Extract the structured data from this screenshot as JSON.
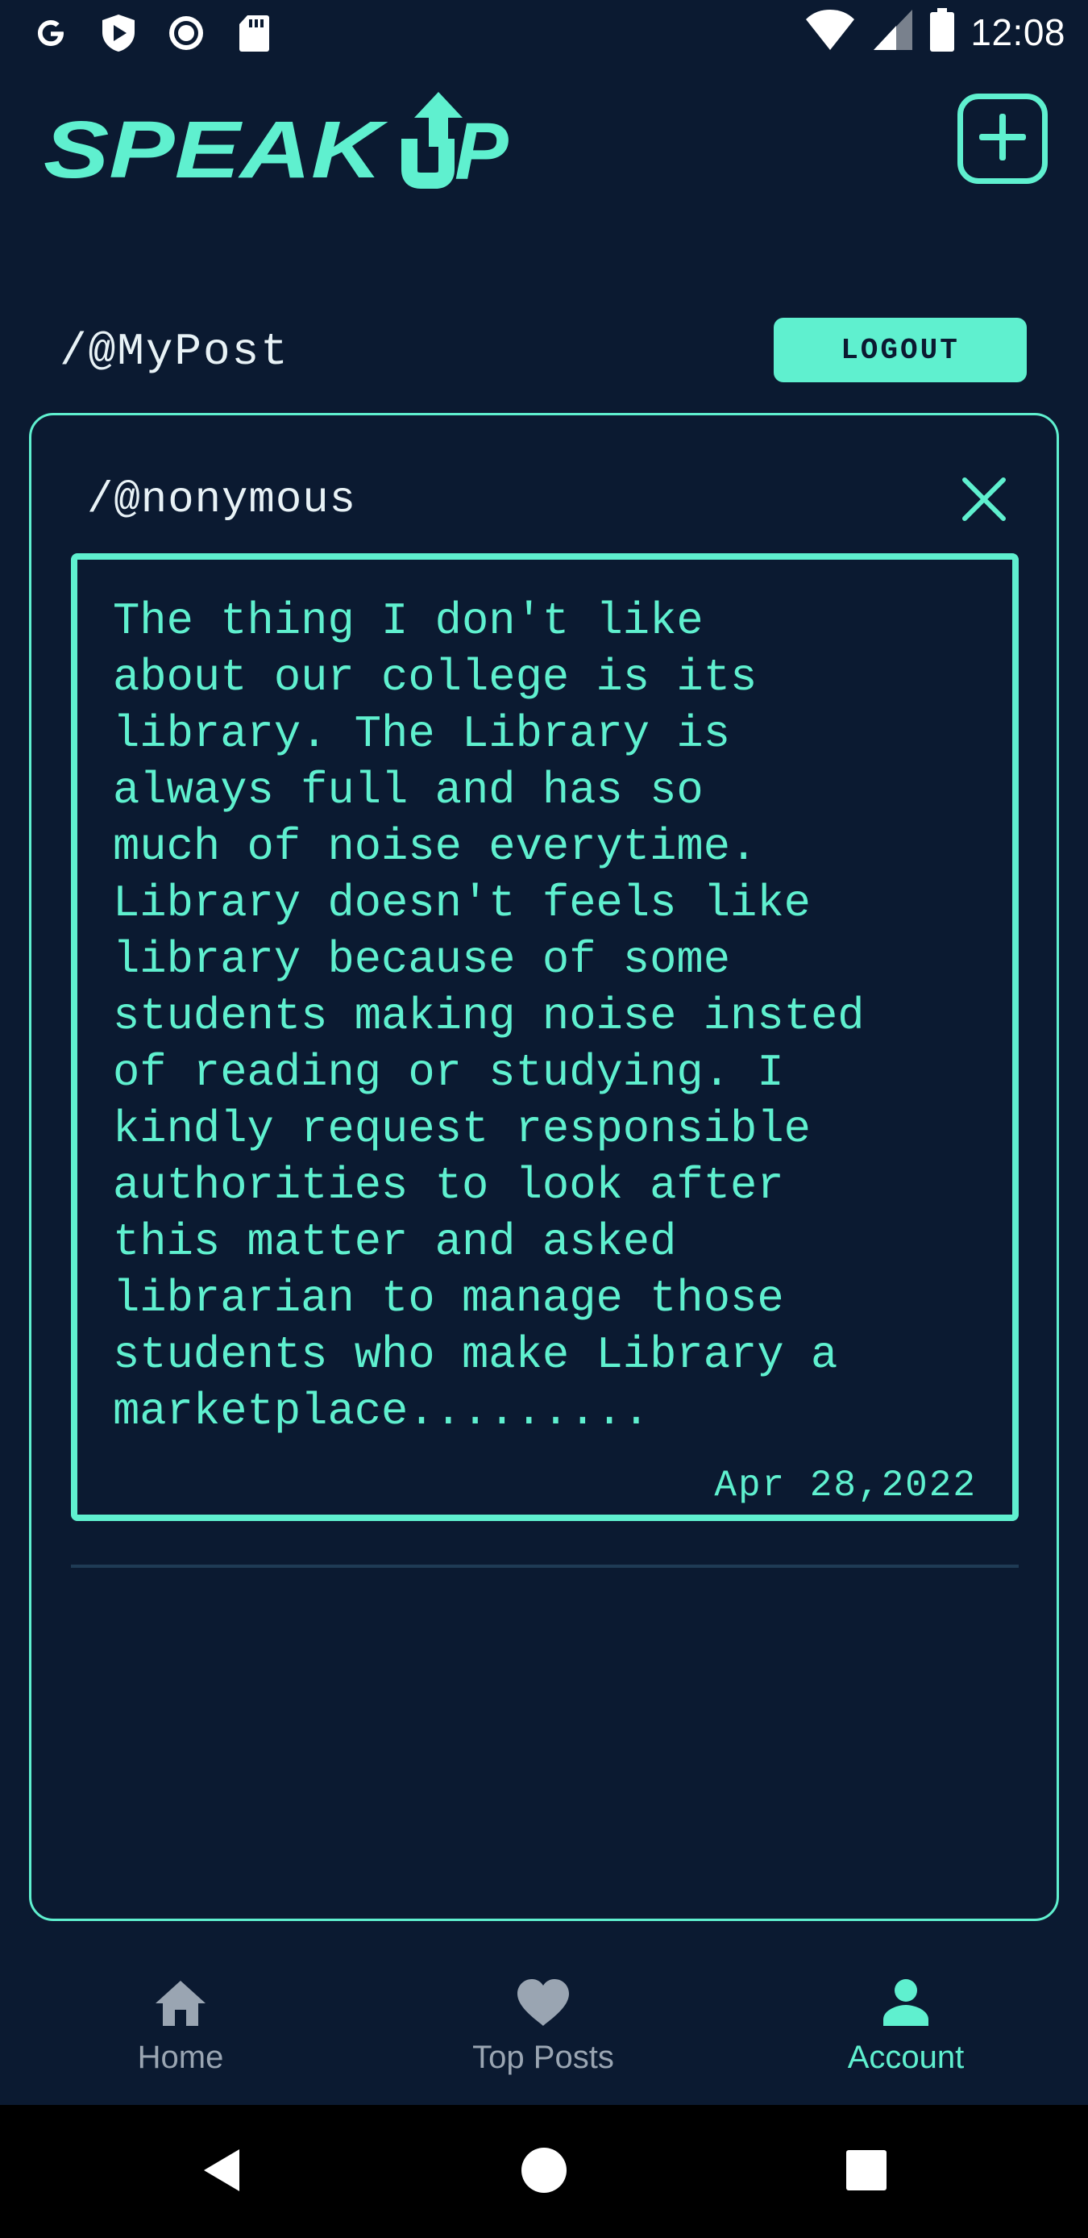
{
  "status_bar": {
    "time": "12:08",
    "left_icons": [
      "google-icon",
      "play-protect-icon",
      "record-icon",
      "sd-card-icon"
    ],
    "right_icons": [
      "wifi-icon",
      "signal-icon",
      "battery-icon"
    ]
  },
  "header": {
    "brand": "SPEAK UP",
    "add_icon": "plus-square-icon"
  },
  "section": {
    "title": "/@MyPost",
    "logout_label": "LOGOUT"
  },
  "post": {
    "author": "/@nonymous",
    "body": "The thing I don't like\nabout our college is its\nlibrary. The Library is\nalways full and has so\nmuch of noise everytime.\nLibrary doesn't feels like\nlibrary because of some\nstudents making noise insted\nof reading or studying. I\nkindly request responsible\nauthorities to look after\nthis matter and asked\nlibrarian to manage those\nstudents who make Library a\nmarketplace.........",
    "date": "Apr 28,2022"
  },
  "bottom_nav": {
    "items": [
      {
        "label": "Home",
        "icon": "home-icon",
        "active": false
      },
      {
        "label": "Top Posts",
        "icon": "heart-icon",
        "active": false
      },
      {
        "label": "Account",
        "icon": "person-icon",
        "active": true
      }
    ]
  },
  "colors": {
    "background": "#0b1a31",
    "accent": "#5ff0cf",
    "muted": "#9aa5b2"
  }
}
